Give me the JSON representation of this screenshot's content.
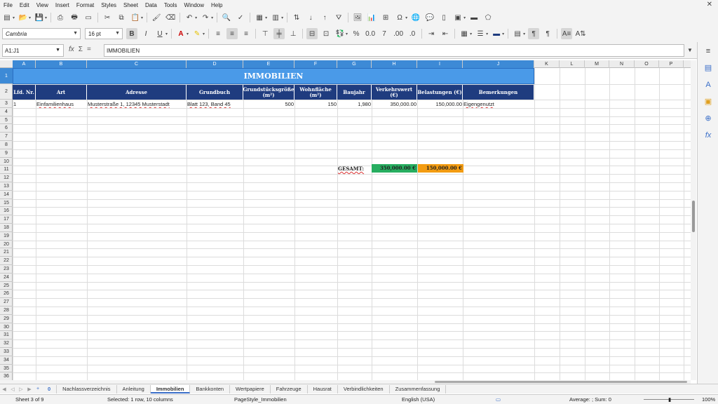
{
  "menubar": [
    "File",
    "Edit",
    "View",
    "Insert",
    "Format",
    "Styles",
    "Sheet",
    "Data",
    "Tools",
    "Window",
    "Help"
  ],
  "formatting": {
    "font_name": "Cambria",
    "font_size": "16 pt"
  },
  "formula_bar": {
    "name_box": "A1:J1",
    "fx": "fx",
    "sum": "Σ",
    "equals": "=",
    "content": "IMMOBILIEN"
  },
  "columns": [
    "A",
    "B",
    "C",
    "D",
    "E",
    "F",
    "G",
    "H",
    "I",
    "J",
    "K",
    "L",
    "M",
    "N",
    "O",
    "P"
  ],
  "rows": [
    "1",
    "2",
    "3",
    "4",
    "5",
    "6",
    "7",
    "8",
    "9",
    "10",
    "11",
    "12",
    "13",
    "14",
    "15",
    "16",
    "17",
    "18",
    "19",
    "20",
    "21",
    "22",
    "23",
    "24",
    "25",
    "26",
    "27",
    "28",
    "29",
    "30",
    "31",
    "32",
    "33",
    "34",
    "35",
    "36",
    "37"
  ],
  "sheet": {
    "title": "IMMOBILIEN",
    "headers": [
      "Lfd. Nr.",
      "Art",
      "Adresse",
      "Grundbuch",
      "Grundstücksgröße (m²)",
      "Wohnfläche (m²)",
      "Baujahr",
      "Verkehrswert (€)",
      "Belastungen (€)",
      "Bemerkungen"
    ],
    "row3": [
      "1",
      "Einfamilienhaus",
      "Musterstraße 1, 12345 Musterstadt",
      "Blatt 123, Band 45",
      "500",
      "150",
      "1,980",
      "350,000.00",
      "150,000.00",
      "Eigengenutzt"
    ],
    "gesamt_label": "GESAMT:",
    "gesamt_value": "350,000.00 €",
    "gesamt_burden": "150,000.00 €",
    "colors": {
      "title_band": "#4a9ae8",
      "header": "#1f3c7f",
      "total_value": "#27ae60",
      "total_burden": "#f39c12"
    }
  },
  "tabs": [
    "0",
    "Nachlassverzeichnis",
    "Anleitung",
    "Immobilien",
    "Bankkonten",
    "Wertpapiere",
    "Fahrzeuge",
    "Hausrat",
    "Verbindlichkeiten",
    "Zusammenfassung"
  ],
  "active_tab": "Immobilien",
  "status": {
    "sheet": "Sheet 3 of 9",
    "selection": "Selected: 1 row, 10 columns",
    "page_style": "PageStyle_Immobilien",
    "language": "English (USA)",
    "aggregate": "Average: ; Sum: 0",
    "zoom": "100%"
  }
}
